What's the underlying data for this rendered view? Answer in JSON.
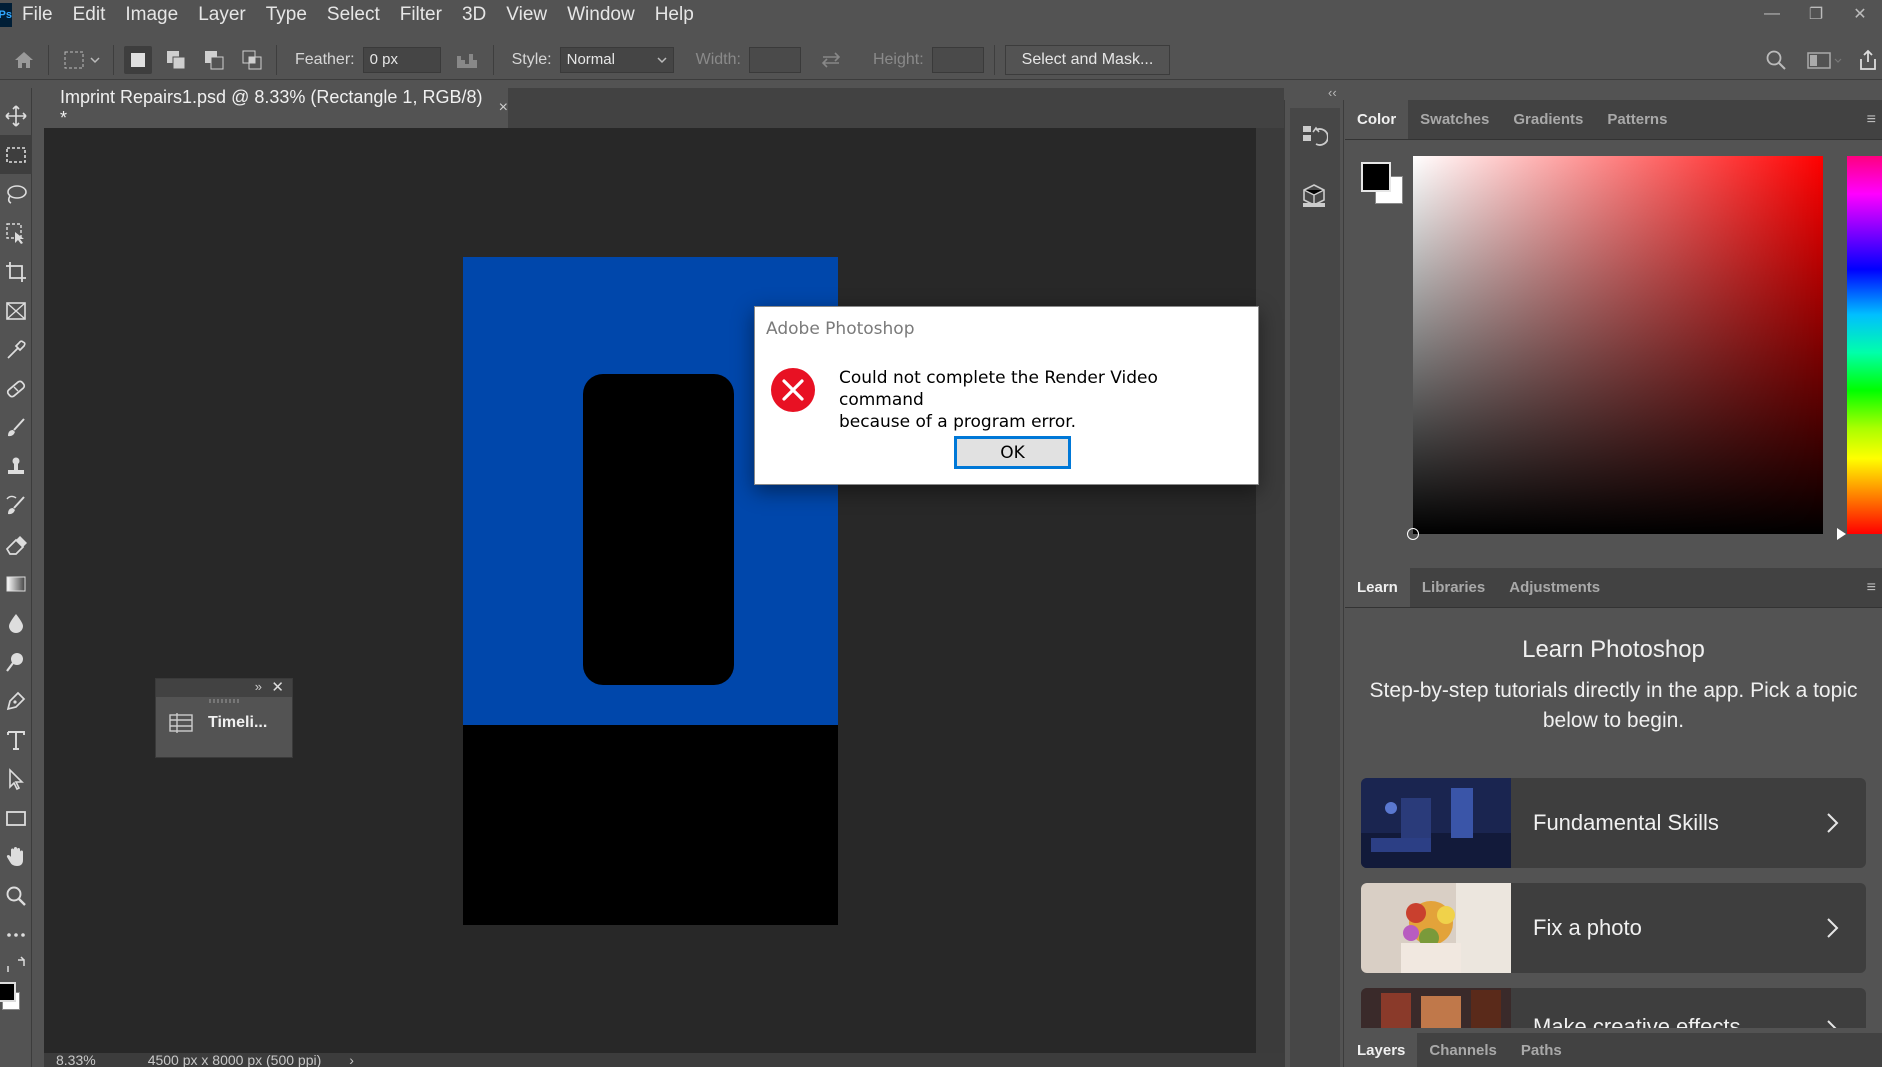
{
  "app": {
    "logo_text": "Ps",
    "menu": [
      "File",
      "Edit",
      "Image",
      "Layer",
      "Type",
      "Select",
      "Filter",
      "3D",
      "View",
      "Window",
      "Help"
    ],
    "window_controls": [
      "—",
      "❐",
      "✕"
    ]
  },
  "options_bar": {
    "feather_label": "Feather:",
    "feather_value": "0 px",
    "style_label": "Style:",
    "style_value": "Normal",
    "width_label": "Width:",
    "height_label": "Height:",
    "select_mask_label": "Select and Mask..."
  },
  "document": {
    "tab_title": "Imprint Repairs1.psd @ 8.33% (Rectangle 1, RGB/8) *",
    "close_glyph": "×",
    "status_zoom": "8.33%",
    "status_info": "4500 px x 8000 px (500 ppi)",
    "status_arrow": "›",
    "colors": {
      "artboard_blue": "#0047ab",
      "artboard_black": "#000000",
      "canvas_bg": "#282828"
    }
  },
  "dialog": {
    "title": "Adobe Photoshop",
    "message_line1": "Could not complete the Render Video command",
    "message_line2": "because of a program error.",
    "ok_label": "OK",
    "icon": "error-icon"
  },
  "floating_panel": {
    "expand_glyph": "»",
    "close_glyph": "✕",
    "label": "Timeli..."
  },
  "color_panel": {
    "tabs": [
      "Color",
      "Swatches",
      "Gradients",
      "Patterns"
    ],
    "active_tab": "Color",
    "foreground": "#000000",
    "background": "#ffffff"
  },
  "learn_panel": {
    "tabs": [
      "Learn",
      "Libraries",
      "Adjustments"
    ],
    "active_tab": "Learn",
    "title": "Learn Photoshop",
    "description": "Step-by-step tutorials directly in the app. Pick a topic below to begin.",
    "tutorials": [
      {
        "label": "Fundamental Skills"
      },
      {
        "label": "Fix a photo"
      },
      {
        "label": "Make creative effects"
      }
    ]
  },
  "layers_panel": {
    "tabs": [
      "Layers",
      "Channels",
      "Paths"
    ],
    "active_tab": "Layers"
  }
}
